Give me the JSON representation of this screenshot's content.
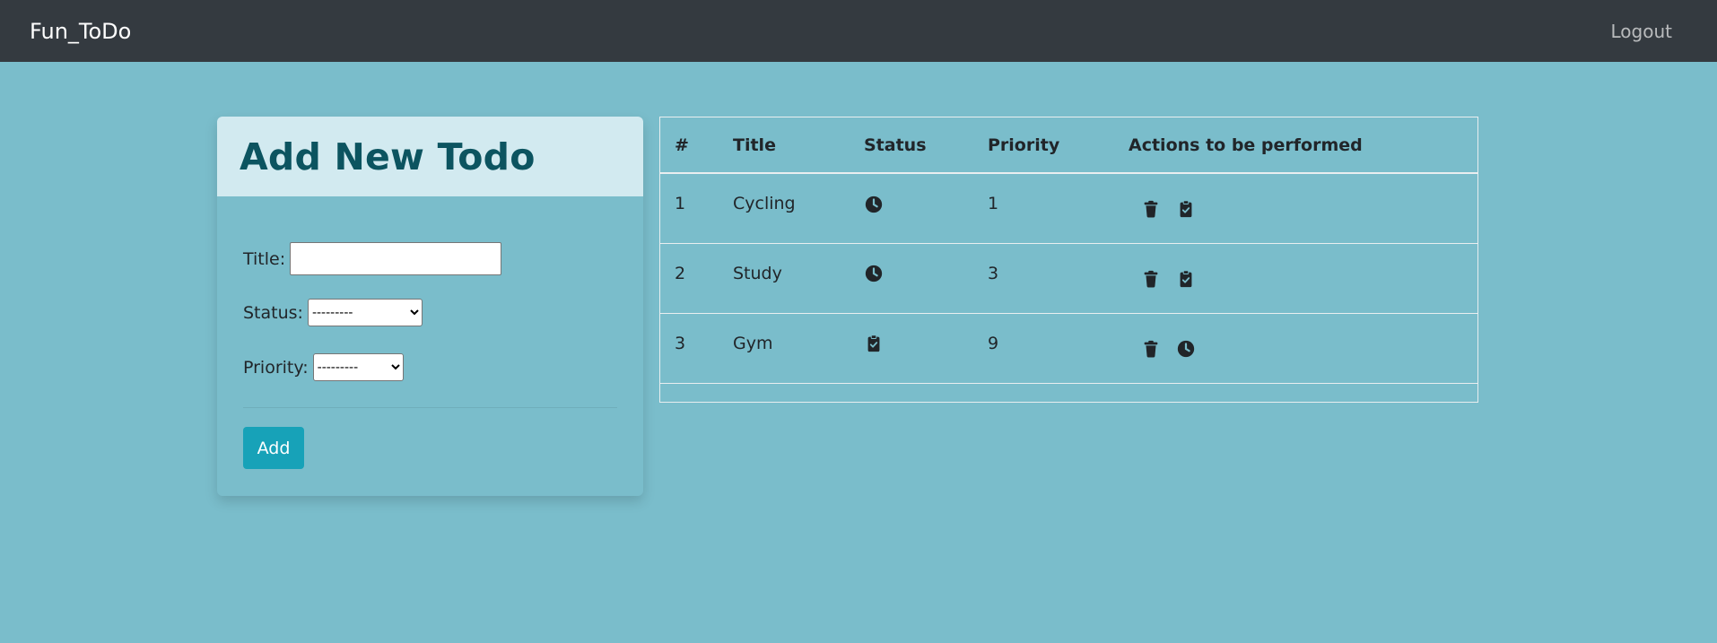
{
  "navbar": {
    "brand": "Fun_ToDo",
    "logout": "Logout"
  },
  "form": {
    "title": "Add New Todo",
    "title_label": "Title:",
    "title_value": "",
    "status_label": "Status:",
    "status_selected": "---------",
    "priority_label": "Priority:",
    "priority_selected": "---------",
    "add_label": "Add"
  },
  "table": {
    "headers": [
      "#",
      "Title",
      "Status",
      "Priority",
      "Actions to be performed"
    ],
    "rows": [
      {
        "num": "1",
        "title": "Cycling",
        "status_icon": "clock-icon",
        "priority": "1",
        "actions": [
          "trash-icon",
          "clipboard-check-icon"
        ]
      },
      {
        "num": "2",
        "title": "Study",
        "status_icon": "clock-icon",
        "priority": "3",
        "actions": [
          "trash-icon",
          "clipboard-check-icon"
        ]
      },
      {
        "num": "3",
        "title": "Gym",
        "status_icon": "clipboard-check-icon",
        "priority": "9",
        "actions": [
          "trash-icon",
          "clock-icon"
        ]
      }
    ]
  },
  "colors": {
    "background": "#7abdcb",
    "navbar": "#343a40",
    "header_bg": "#d2eaf0",
    "title": "#0c5460",
    "accent": "#17a2b8"
  }
}
